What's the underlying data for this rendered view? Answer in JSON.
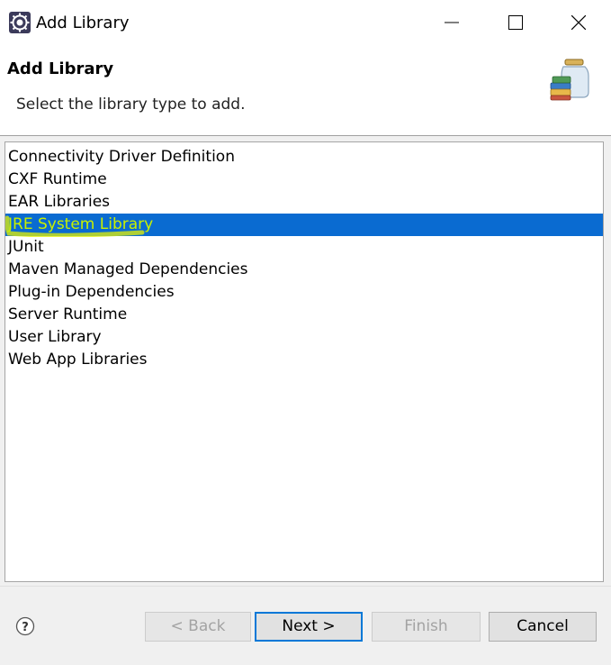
{
  "window": {
    "title": "Add Library"
  },
  "header": {
    "title": "Add Library",
    "description": "Select the library type to add."
  },
  "library_types": [
    {
      "label": "Connectivity Driver Definition",
      "selected": false
    },
    {
      "label": "CXF Runtime",
      "selected": false
    },
    {
      "label": "EAR Libraries",
      "selected": false
    },
    {
      "label": "JRE System Library",
      "selected": true
    },
    {
      "label": "JUnit",
      "selected": false
    },
    {
      "label": "Maven Managed Dependencies",
      "selected": false
    },
    {
      "label": "Plug-in Dependencies",
      "selected": false
    },
    {
      "label": "Server Runtime",
      "selected": false
    },
    {
      "label": "User Library",
      "selected": false
    },
    {
      "label": "Web App Libraries",
      "selected": false
    }
  ],
  "buttons": {
    "back": "< Back",
    "next": "Next >",
    "finish": "Finish",
    "cancel": "Cancel"
  },
  "colors": {
    "selection": "#0a6bd1",
    "annotation_highlight": "#e6f000",
    "default_button_border": "#0078d7"
  },
  "icons": {
    "app": "eclipse-icon",
    "wizard": "library-jar-icon",
    "help": "help-icon"
  }
}
